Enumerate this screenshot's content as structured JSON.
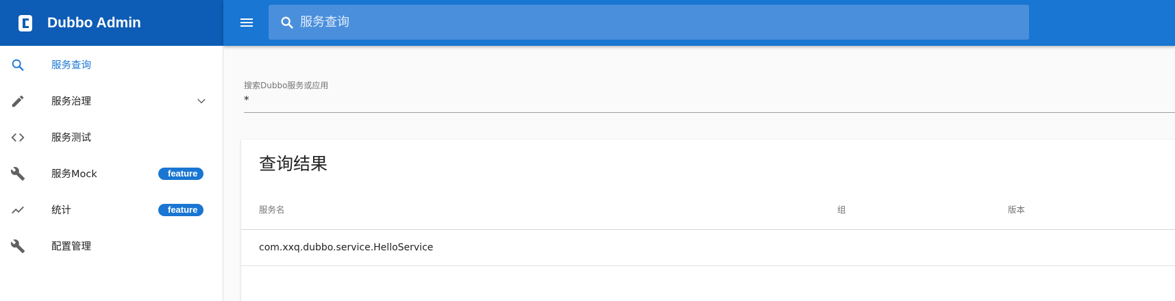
{
  "header": {
    "app_title": "Dubbo Admin",
    "logo_icon": "dubbo-logo-icon",
    "menu_icon": "hamburger-menu-icon",
    "search": {
      "placeholder": "服务查询",
      "icon": "search-icon"
    }
  },
  "sidebar": {
    "items": [
      {
        "label": "服务查询",
        "icon": "search-icon",
        "active": true
      },
      {
        "label": "服务治理",
        "icon": "pencil-icon",
        "expandable": true,
        "chevron_icon": "chevron-down-icon"
      },
      {
        "label": "服务测试",
        "icon": "code-icon"
      },
      {
        "label": "服务Mock",
        "icon": "wrench-icon",
        "badge": "feature"
      },
      {
        "label": "统计",
        "icon": "trending-up-icon",
        "badge": "feature"
      },
      {
        "label": "配置管理",
        "icon": "wrench-icon"
      }
    ]
  },
  "search_field": {
    "label": "搜索Dubbo服务或应用",
    "value": "*"
  },
  "results": {
    "title": "查询结果",
    "columns": [
      "服务名",
      "组",
      "版本"
    ],
    "rows": [
      {
        "service": "com.xxq.dubbo.service.HelloService",
        "group": "",
        "version": ""
      }
    ]
  },
  "colors": {
    "primary": "#1976d2",
    "header_dark": "#0d5cb5",
    "search_bg": "#4a8fdc"
  }
}
